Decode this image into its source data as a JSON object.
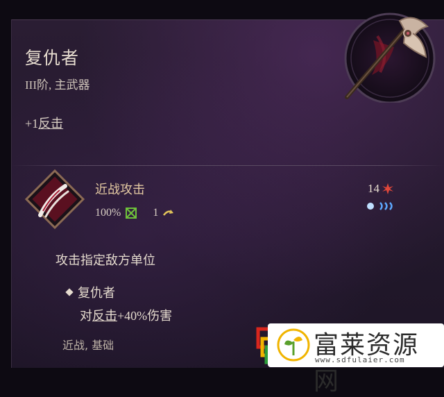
{
  "item": {
    "name": "复仇者",
    "subtitle": "III阶, 主武器",
    "bonus_prefix": "+1",
    "bonus_link": "反击"
  },
  "ability": {
    "name": "近战攻击",
    "accuracy": "100%",
    "cooldown": "1",
    "cost": "14",
    "description": "攻击指定敌方单位",
    "passive_name": "复仇者",
    "passive_prefix": "对",
    "passive_link": "反击",
    "passive_value": "+40%",
    "passive_suffix": "伤害",
    "tags": "近战, 基础"
  },
  "watermark": {
    "brand": "富莱资源网",
    "url": "www.sdfulaier.com"
  },
  "icons": {
    "weapon": "battle-axe-icon",
    "ability": "claw-slash-icon",
    "accuracy": "target-icon",
    "cooldown": "cooldown-arrow-icon",
    "cost": "star-burst-icon",
    "resource": "moon-charges-icon"
  },
  "colors": {
    "ability_name": "#e4c9a2",
    "text": "#e6dccf",
    "accuracy_icon": "#6ec23b",
    "cost_icon": "#e0473a",
    "resource_icon": "#5da8ff"
  }
}
